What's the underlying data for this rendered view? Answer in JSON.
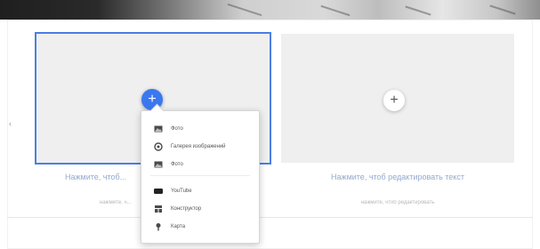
{
  "colors": {
    "accent": "#3b78f0",
    "selection_outline": "#4a7ee6",
    "placeholder_bg": "#efefef",
    "caption_text": "#92aacd"
  },
  "side_marker": "‹",
  "blocks": [
    {
      "id": "left",
      "add_icon": "+",
      "caption": "Нажмите, чтоб...",
      "subcaption": "нажмите, ч..."
    },
    {
      "id": "right",
      "add_icon": "+",
      "caption": "Нажмите, чтоб редактировать текст",
      "subcaption": "нажмите, чтоб редактировать"
    }
  ],
  "menu": {
    "items": [
      {
        "label": "Фото",
        "icon": "image-icon"
      },
      {
        "label": "Галерея изображений",
        "icon": "gallery-icon"
      },
      {
        "label": "Фото",
        "icon": "image-icon"
      },
      {
        "label": "YouTube",
        "icon": "youtube-icon"
      },
      {
        "label": "Конструктор",
        "icon": "constructor-icon"
      },
      {
        "label": "Карта",
        "icon": "map-pin-icon"
      }
    ]
  }
}
